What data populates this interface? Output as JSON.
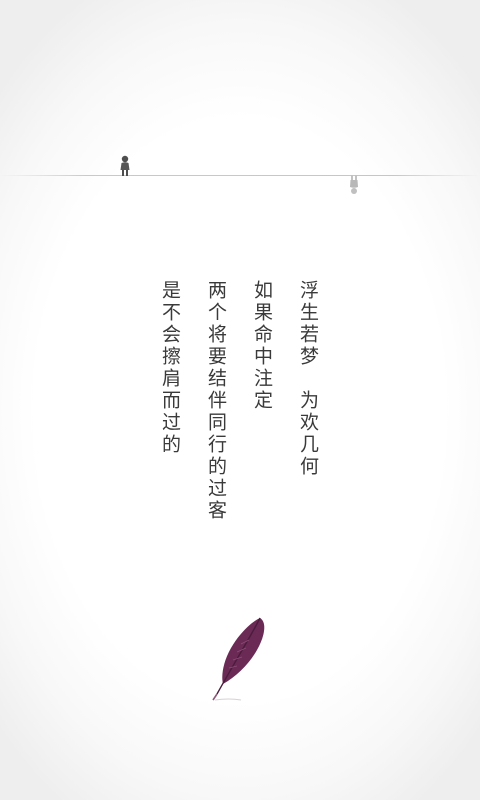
{
  "poem": {
    "lines": [
      "浮生若梦　为欢几何",
      "如果命中注定",
      "两个将要结伴同行的过客",
      "是不会擦肩而过的"
    ]
  },
  "icons": {
    "walker": "person-walking-icon",
    "reflection": "person-reflection-icon",
    "feather": "feather-quill-icon"
  },
  "colors": {
    "background": "#ffffff",
    "text": "#3a3a3a",
    "horizon": "#c6c6c6",
    "figure": "#555555",
    "reflection": "#b8b8b8",
    "feather": "#6b2a55"
  }
}
